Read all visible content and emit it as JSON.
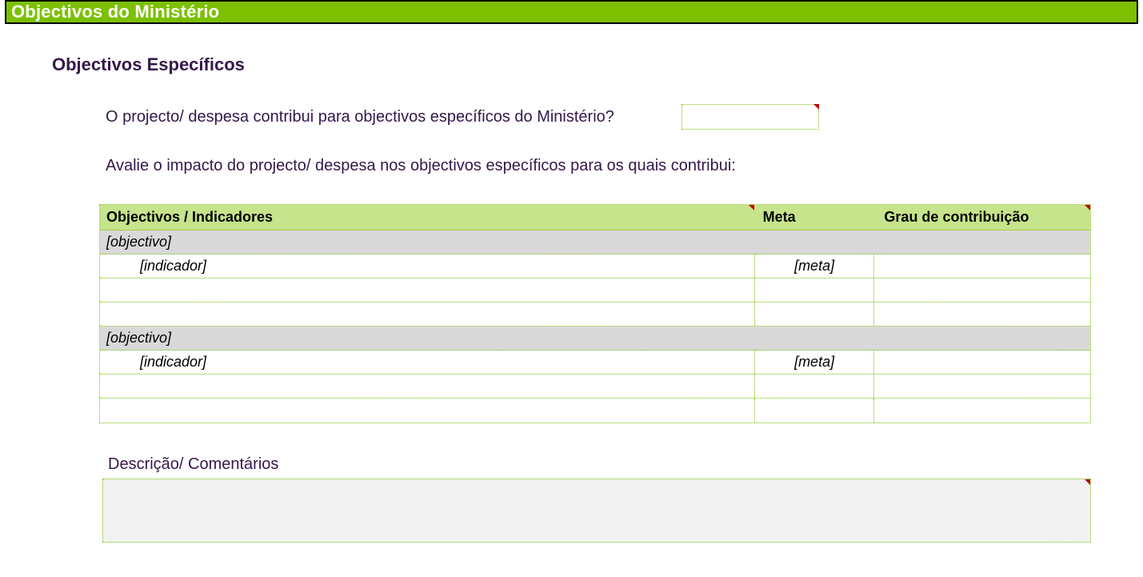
{
  "banner": {
    "title": "Objectivos do Ministério"
  },
  "section": {
    "subtitle": "Objectivos Específicos"
  },
  "question": {
    "text": "O projecto/ despesa contribui para objectivos específicos do Ministério?",
    "value": ""
  },
  "instruction": "Avalie o impacto do projecto/ despesa nos objectivos específicos para os quais contribui:",
  "table": {
    "headers": {
      "col1": "Objectivos / Indicadores",
      "col2": "Meta",
      "col3": "Grau de contribuição"
    },
    "groups": [
      {
        "label": "[objectivo]",
        "rows": [
          {
            "indicator": "[indicador]",
            "meta": "[meta]",
            "grau": ""
          },
          {
            "indicator": "",
            "meta": "",
            "grau": ""
          },
          {
            "indicator": "",
            "meta": "",
            "grau": ""
          }
        ]
      },
      {
        "label": "[objectivo]",
        "rows": [
          {
            "indicator": "[indicador]",
            "meta": "[meta]",
            "grau": ""
          },
          {
            "indicator": "",
            "meta": "",
            "grau": ""
          },
          {
            "indicator": "",
            "meta": "",
            "grau": ""
          }
        ]
      }
    ]
  },
  "description": {
    "label": "Descrição/ Comentários",
    "value": ""
  }
}
